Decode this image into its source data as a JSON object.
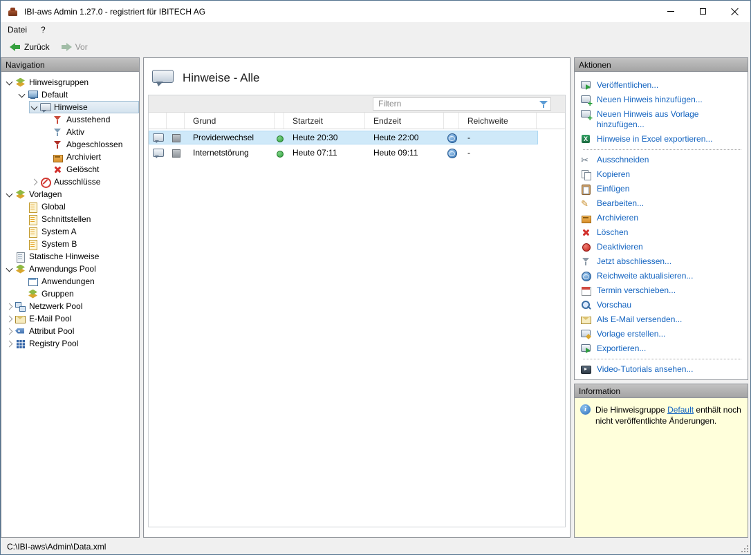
{
  "window": {
    "title": "IBI-aws Admin 1.27.0 - registriert für IBITECH AG"
  },
  "menubar": {
    "items": [
      {
        "label": "Datei"
      },
      {
        "label": "?"
      }
    ]
  },
  "toolbar": {
    "back_label": "Zurück",
    "forward_label": "Vor"
  },
  "navigation": {
    "header": "Navigation",
    "items": [
      {
        "label": "Hinweisgruppen",
        "level": 0,
        "expand": "open",
        "icon": "stack-icon"
      },
      {
        "label": "Default",
        "level": 1,
        "expand": "open",
        "icon": "monitor-icon"
      },
      {
        "label": "Hinweise",
        "level": 2,
        "expand": "open",
        "icon": "bubble-icon",
        "selected": true
      },
      {
        "label": "Ausstehend",
        "level": 3,
        "expand": "none",
        "icon": "funnel-red-icon"
      },
      {
        "label": "Aktiv",
        "level": 3,
        "expand": "none",
        "icon": "funnel-blue-icon"
      },
      {
        "label": "Abgeschlossen",
        "level": 3,
        "expand": "none",
        "icon": "funnel-darkred-icon"
      },
      {
        "label": "Archiviert",
        "level": 3,
        "expand": "none",
        "icon": "archive-icon"
      },
      {
        "label": "Gelöscht",
        "level": 3,
        "expand": "none",
        "icon": "delete-icon"
      },
      {
        "label": "Ausschlüsse",
        "level": 2,
        "expand": "closed",
        "icon": "blocked-icon"
      },
      {
        "label": "Vorlagen",
        "level": 0,
        "expand": "open",
        "icon": "stack-icon"
      },
      {
        "label": "Global",
        "level": 1,
        "expand": "none",
        "icon": "template-icon"
      },
      {
        "label": "Schnittstellen",
        "level": 1,
        "expand": "none",
        "icon": "template-icon"
      },
      {
        "label": "System A",
        "level": 1,
        "expand": "none",
        "icon": "template-icon"
      },
      {
        "label": "System B",
        "level": 1,
        "expand": "none",
        "icon": "template-icon"
      },
      {
        "label": "Statische Hinweise",
        "level": 0,
        "expand": "none",
        "icon": "static-icon"
      },
      {
        "label": "Anwendungs Pool",
        "level": 0,
        "expand": "open",
        "icon": "stack-icon"
      },
      {
        "label": "Anwendungen",
        "level": 1,
        "expand": "none",
        "icon": "window-icon"
      },
      {
        "label": "Gruppen",
        "level": 1,
        "expand": "none",
        "icon": "stack-icon"
      },
      {
        "label": "Netzwerk Pool",
        "level": 0,
        "expand": "closed",
        "icon": "network-icon"
      },
      {
        "label": "E-Mail Pool",
        "level": 0,
        "expand": "closed",
        "icon": "mail-icon"
      },
      {
        "label": "Attribut Pool",
        "level": 0,
        "expand": "closed",
        "icon": "tag-icon"
      },
      {
        "label": "Registry Pool",
        "level": 0,
        "expand": "closed",
        "icon": "grid-icon"
      }
    ]
  },
  "main": {
    "title": "Hinweise - Alle",
    "filter_placeholder": "Filtern",
    "table": {
      "columns": [
        {
          "key": "icon_bubble",
          "label": "",
          "type": "icon",
          "icon": "bubble-icon"
        },
        {
          "key": "icon_square",
          "label": "",
          "type": "icon",
          "icon": "square-icon"
        },
        {
          "key": "grund",
          "label": "Grund",
          "type": "text"
        },
        {
          "key": "status",
          "label": "",
          "type": "icon",
          "icon": "dot-green-icon"
        },
        {
          "key": "startzeit",
          "label": "Startzeit",
          "type": "text"
        },
        {
          "key": "endzeit",
          "label": "Endzeit",
          "type": "text"
        },
        {
          "key": "globe",
          "label": "",
          "type": "icon",
          "icon": "globe-icon"
        },
        {
          "key": "reichweite",
          "label": "Reichweite",
          "type": "text"
        }
      ],
      "rows": [
        {
          "grund": "Providerwechsel",
          "startzeit": "Heute 20:30",
          "endzeit": "Heute 22:00",
          "reichweite": "-",
          "selected": true
        },
        {
          "grund": "Internetstörung",
          "startzeit": "Heute 07:11",
          "endzeit": "Heute 09:11",
          "reichweite": "-",
          "selected": false
        }
      ]
    }
  },
  "actions": {
    "header": "Aktionen",
    "groups": [
      {
        "items": [
          {
            "label": "Veröffentlichen...",
            "icon": "publish-icon"
          },
          {
            "label": "Neuen Hinweis hinzufügen...",
            "icon": "add-hint-icon"
          },
          {
            "label": "Neuen Hinweis aus Vorlage hinzufügen...",
            "icon": "add-from-template-icon"
          },
          {
            "label": "Hinweise in Excel exportieren...",
            "icon": "excel-icon"
          }
        ]
      },
      {
        "items": [
          {
            "label": "Ausschneiden",
            "icon": "cut-icon"
          },
          {
            "label": "Kopieren",
            "icon": "copy-icon"
          },
          {
            "label": "Einfügen",
            "icon": "paste-icon"
          },
          {
            "label": "Bearbeiten...",
            "icon": "edit-icon"
          },
          {
            "label": "Archivieren",
            "icon": "archive-icon"
          },
          {
            "label": "Löschen",
            "icon": "delete-icon"
          },
          {
            "label": "Deaktivieren",
            "icon": "deactivate-icon"
          },
          {
            "label": "Jetzt abschliessen...",
            "icon": "funnel-gray-icon"
          },
          {
            "label": "Reichweite aktualisieren...",
            "icon": "globe-icon"
          },
          {
            "label": "Termin verschieben...",
            "icon": "calendar-icon"
          },
          {
            "label": "Vorschau",
            "icon": "preview-icon"
          },
          {
            "label": "Als E-Mail versenden...",
            "icon": "mail-icon"
          },
          {
            "label": "Vorlage erstellen...",
            "icon": "create-template-icon"
          },
          {
            "label": "Exportieren...",
            "icon": "export-icon"
          }
        ]
      },
      {
        "items": [
          {
            "label": "Video-Tutorials ansehen...",
            "icon": "video-icon"
          }
        ]
      }
    ]
  },
  "information": {
    "header": "Information",
    "text_before": "Die Hinweisgruppe ",
    "link": "Default",
    "text_after": " enthält noch nicht veröffentlichte Änderungen."
  },
  "statusbar": {
    "path": "C:\\IBI-aws\\Admin\\Data.xml"
  }
}
